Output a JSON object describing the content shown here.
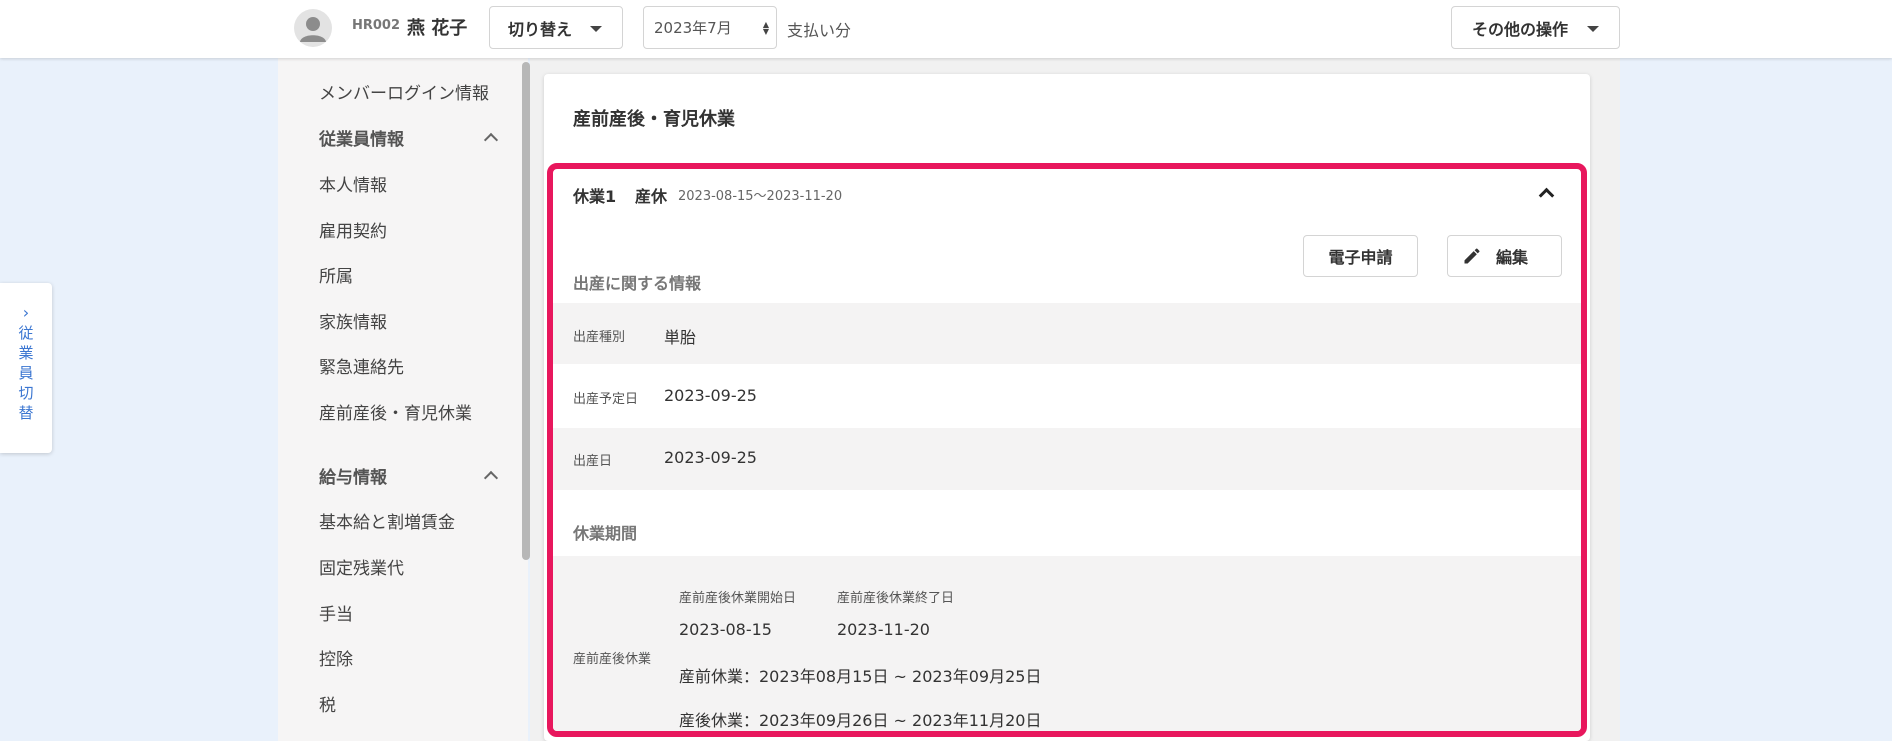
{
  "header": {
    "employee_code": "HR002",
    "employee_name": "燕 花子",
    "switch_label": "切り替え",
    "month_value": "2023年7月",
    "pay_label": "支払い分",
    "other_actions_label": "その他の操作"
  },
  "employee_switch_panel": {
    "chars": [
      "従",
      "業",
      "員",
      "切",
      "替"
    ]
  },
  "sidebar": {
    "member_login": "メンバーログイン情報",
    "group_employee": "従業員情報",
    "employee_items": [
      "本人情報",
      "雇用契約",
      "所属",
      "家族情報",
      "緊急連絡先",
      "産前産後・育児休業"
    ],
    "group_salary": "給与情報",
    "salary_items": [
      "基本給と割増賃金",
      "固定残業代",
      "手当",
      "控除",
      "税"
    ]
  },
  "card": {
    "title": "産前産後・育児休業",
    "leave_title": "休業1",
    "leave_type": "産休",
    "leave_range": "2023-08-15〜2023-11-20",
    "e_application_label": "電子申請",
    "edit_label": "編集",
    "birth_section_title": "出産に関する情報",
    "birth_type_label": "出産種別",
    "birth_type_value": "単胎",
    "due_date_label": "出産予定日",
    "due_date_value": "2023-09-25",
    "birth_date_label": "出産日",
    "birth_date_value": "2023-09-25",
    "leave_period_title": "休業期間",
    "maternity_label": "産前産後休業",
    "start_label": "産前産後休業開始日",
    "end_label": "産前産後休業終了日",
    "start_value": "2023-08-15",
    "end_value": "2023-11-20",
    "prenatal_line": "産前休業：2023年08月15日 ~ 2023年09月25日",
    "postnatal_line": "産後休業：2023年09月26日 ~ 2023年11月20日"
  },
  "colors": {
    "highlight": "#e8175d",
    "accent": "#3b76d1",
    "page_bg": "#e9f1fb"
  },
  "icons": [
    "user-avatar-icon",
    "caret-down-icon",
    "chevron-right-icon",
    "chevron-up-icon",
    "pencil-icon"
  ]
}
